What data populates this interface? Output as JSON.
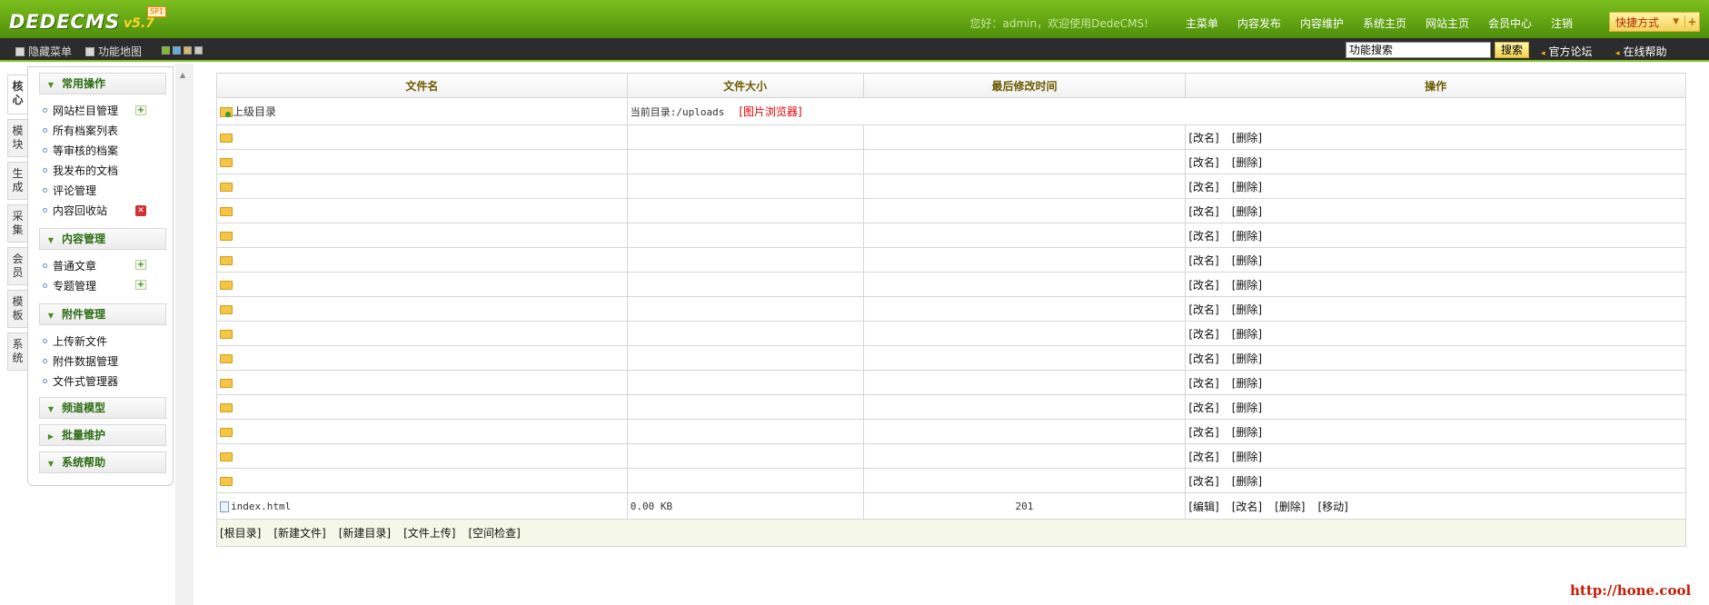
{
  "header": {
    "logo_text": "DEDECMS",
    "logo_version": "v5.7",
    "logo_badge": "SP1",
    "welcome": "您好：admin，欢迎使用DedeCMS!",
    "nav": [
      "主菜单",
      "内容发布",
      "内容维护",
      "系统主页",
      "网站主页",
      "会员中心",
      "注销"
    ],
    "quick_label": "快捷方式",
    "quick_add": "+"
  },
  "toolbar": {
    "hide_menu": "隐藏菜单",
    "site_map": "功能地图",
    "search_value": "功能搜索",
    "search_button": "搜索",
    "official_forum": "官方论坛",
    "online_help": "在线帮助"
  },
  "vtabs": [
    "核心",
    "模块",
    "生成",
    "采集",
    "会员",
    "模板",
    "系统"
  ],
  "menu": {
    "groups": [
      {
        "title": "常用操作",
        "items": [
          "网站栏目管理",
          "所有档案列表",
          "等审核的档案",
          "我发布的文档",
          "评论管理",
          "内容回收站"
        ]
      },
      {
        "title": "内容管理",
        "items": [
          "普通文章",
          "专题管理"
        ]
      },
      {
        "title": "附件管理",
        "items": [
          "上传新文件",
          "附件数据管理",
          "文件式管理器"
        ]
      },
      {
        "title": "频道模型",
        "items": []
      },
      {
        "title": "批量维护",
        "items": []
      },
      {
        "title": "系统帮助",
        "items": []
      }
    ]
  },
  "table": {
    "headers": [
      "文件名",
      "文件大小",
      "最后修改时间",
      "操作"
    ],
    "parent_dir": "上级目录",
    "current_dir_label": "当前目录:/uploads",
    "image_browser": "[图片浏览器]",
    "dir_actions": [
      "[改名]",
      "[删除]"
    ],
    "dir_count": 15,
    "file": {
      "name": "index.html",
      "size": "0.00 KB",
      "modified": "201",
      "actions": [
        "[编辑]",
        "[改名]",
        "[删除]",
        "[移动]"
      ]
    },
    "footer_actions": [
      "[根目录]",
      "[新建文件]",
      "[新建目录]",
      "[文件上传]",
      "[空间检查]"
    ]
  },
  "watermark": "http://hone.cool",
  "colors": {
    "header_green": "#5fa514",
    "toolbar_dark": "#2c2c2c",
    "menu_title_green": "#2c6d14",
    "table_header_text": "#6b5a00",
    "link_red": "#e60000"
  }
}
